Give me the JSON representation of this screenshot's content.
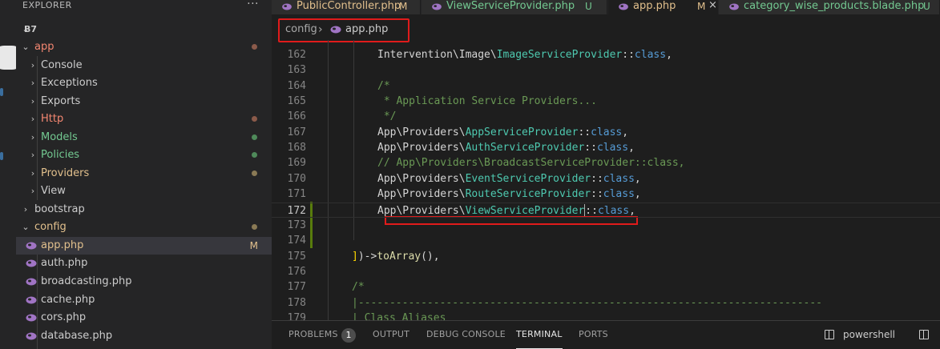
{
  "colors": {
    "accent_red": "#e01b1b",
    "modified": "#e2c08d",
    "git_green_dot": "#73c991",
    "untracked_green": "#73c991",
    "error_red": "#f48771",
    "php_icon": "#a074c4"
  },
  "sidebar": {
    "header": "EXPLORER",
    "more_icon": "ellipsis-icon",
    "root": "B7",
    "items": [
      {
        "label": "app",
        "type": "folder",
        "open": true,
        "color": "#f48771",
        "dot": "#8b5a4a"
      },
      {
        "label": "Console",
        "type": "folder",
        "open": false,
        "color": "#cccccc"
      },
      {
        "label": "Exceptions",
        "type": "folder",
        "open": false,
        "color": "#cccccc"
      },
      {
        "label": "Exports",
        "type": "folder",
        "open": false,
        "color": "#cccccc"
      },
      {
        "label": "Http",
        "type": "folder",
        "open": false,
        "color": "#f48771",
        "dot": "#8b5a4a"
      },
      {
        "label": "Models",
        "type": "folder",
        "open": false,
        "color": "#73c991",
        "dot": "#4f8a5a"
      },
      {
        "label": "Policies",
        "type": "folder",
        "open": false,
        "color": "#73c991",
        "dot": "#4f8a5a"
      },
      {
        "label": "Providers",
        "type": "folder",
        "open": false,
        "color": "#e2c08d",
        "dot": "#8a7a55"
      },
      {
        "label": "View",
        "type": "folder",
        "open": false,
        "color": "#cccccc"
      },
      {
        "label": "bootstrap",
        "type": "folder",
        "open": false,
        "color": "#cccccc"
      },
      {
        "label": "config",
        "type": "folder",
        "open": true,
        "color": "#e2c08d",
        "dot": "#8a7a55"
      },
      {
        "label": "app.php",
        "type": "file",
        "color": "#e2c08d",
        "badge": "M",
        "selected": true
      },
      {
        "label": "auth.php",
        "type": "file",
        "color": "#cccccc"
      },
      {
        "label": "broadcasting.php",
        "type": "file",
        "color": "#cccccc"
      },
      {
        "label": "cache.php",
        "type": "file",
        "color": "#cccccc"
      },
      {
        "label": "cors.php",
        "type": "file",
        "color": "#cccccc"
      },
      {
        "label": "database.php",
        "type": "file",
        "color": "#cccccc"
      }
    ]
  },
  "tabs": [
    {
      "label": "PublicController.php",
      "status": "M",
      "status_color": "#e2c08d",
      "active": false
    },
    {
      "label": "ViewServiceProvider.php",
      "status": "U",
      "status_color": "#73c991",
      "active": false
    },
    {
      "label": "app.php",
      "status": "M",
      "status_color": "#e2c08d",
      "active": true,
      "close": "×"
    },
    {
      "label": "category_wise_products.blade.php",
      "status": "U",
      "status_color": "#73c991",
      "active": false
    }
  ],
  "breadcrumb": {
    "folder": "config",
    "separator": "›",
    "file": "app.php"
  },
  "editor": {
    "current_line": 172,
    "lines": [
      {
        "n": "162",
        "tokens": [
          [
            "ns",
            "Intervention\\Image\\"
          ],
          [
            "cls",
            "ImageServiceProvider"
          ],
          [
            "ns",
            "::"
          ],
          [
            "kw",
            "class"
          ],
          [
            "ns",
            ","
          ]
        ]
      },
      {
        "n": "163",
        "tokens": []
      },
      {
        "n": "164",
        "tokens": [
          [
            "cm",
            "/*"
          ]
        ]
      },
      {
        "n": "165",
        "tokens": [
          [
            "cm",
            " * Application Service Providers..."
          ]
        ]
      },
      {
        "n": "166",
        "tokens": [
          [
            "cm",
            " */"
          ]
        ]
      },
      {
        "n": "167",
        "tokens": [
          [
            "ns",
            "App\\Providers\\"
          ],
          [
            "cls",
            "AppServiceProvider"
          ],
          [
            "ns",
            "::"
          ],
          [
            "kw",
            "class"
          ],
          [
            "ns",
            ","
          ]
        ]
      },
      {
        "n": "168",
        "tokens": [
          [
            "ns",
            "App\\Providers\\"
          ],
          [
            "cls",
            "AuthServiceProvider"
          ],
          [
            "ns",
            "::"
          ],
          [
            "kw",
            "class"
          ],
          [
            "ns",
            ","
          ]
        ]
      },
      {
        "n": "169",
        "tokens": [
          [
            "cm",
            "// App\\Providers\\BroadcastServiceProvider::class,"
          ]
        ]
      },
      {
        "n": "170",
        "tokens": [
          [
            "ns",
            "App\\Providers\\"
          ],
          [
            "cls",
            "EventServiceProvider"
          ],
          [
            "ns",
            "::"
          ],
          [
            "kw",
            "class"
          ],
          [
            "ns",
            ","
          ]
        ]
      },
      {
        "n": "171",
        "tokens": [
          [
            "ns",
            "App\\Providers\\"
          ],
          [
            "cls",
            "RouteServiceProvider"
          ],
          [
            "ns",
            "::"
          ],
          [
            "kw",
            "class"
          ],
          [
            "ns",
            ","
          ]
        ]
      },
      {
        "n": "172",
        "tokens": [
          [
            "ns",
            "App\\Providers\\"
          ],
          [
            "cls",
            "ViewServiceProvider"
          ],
          [
            "cursor",
            ""
          ],
          [
            "ns",
            "::"
          ],
          [
            "kw",
            "class"
          ],
          [
            "ns",
            ","
          ]
        ]
      },
      {
        "n": "173",
        "tokens": []
      },
      {
        "n": "174",
        "tokens": []
      },
      {
        "n": "175",
        "tokens": [
          [
            "br",
            "]"
          ],
          [
            "ns",
            ")->"
          ],
          [
            "fn",
            "toArray"
          ],
          [
            "ns",
            "(),"
          ]
        ]
      },
      {
        "n": "176",
        "tokens": []
      },
      {
        "n": "177",
        "tokens": [
          [
            "cm",
            "/*"
          ]
        ]
      },
      {
        "n": "178",
        "tokens": [
          [
            "cm",
            "|--------------------------------------------------------------------------"
          ]
        ]
      },
      {
        "n": "179",
        "tokens": [
          [
            "cm",
            "| Class Aliases"
          ]
        ]
      }
    ]
  },
  "panel": {
    "tabs": [
      {
        "label": "PROBLEMS",
        "active": false
      },
      {
        "label": "OUTPUT",
        "active": false
      },
      {
        "label": "DEBUG CONSOLE",
        "active": false
      },
      {
        "label": "TERMINAL",
        "active": true
      },
      {
        "label": "PORTS",
        "active": false
      }
    ],
    "problems_count": "1",
    "shell": "powershell"
  }
}
